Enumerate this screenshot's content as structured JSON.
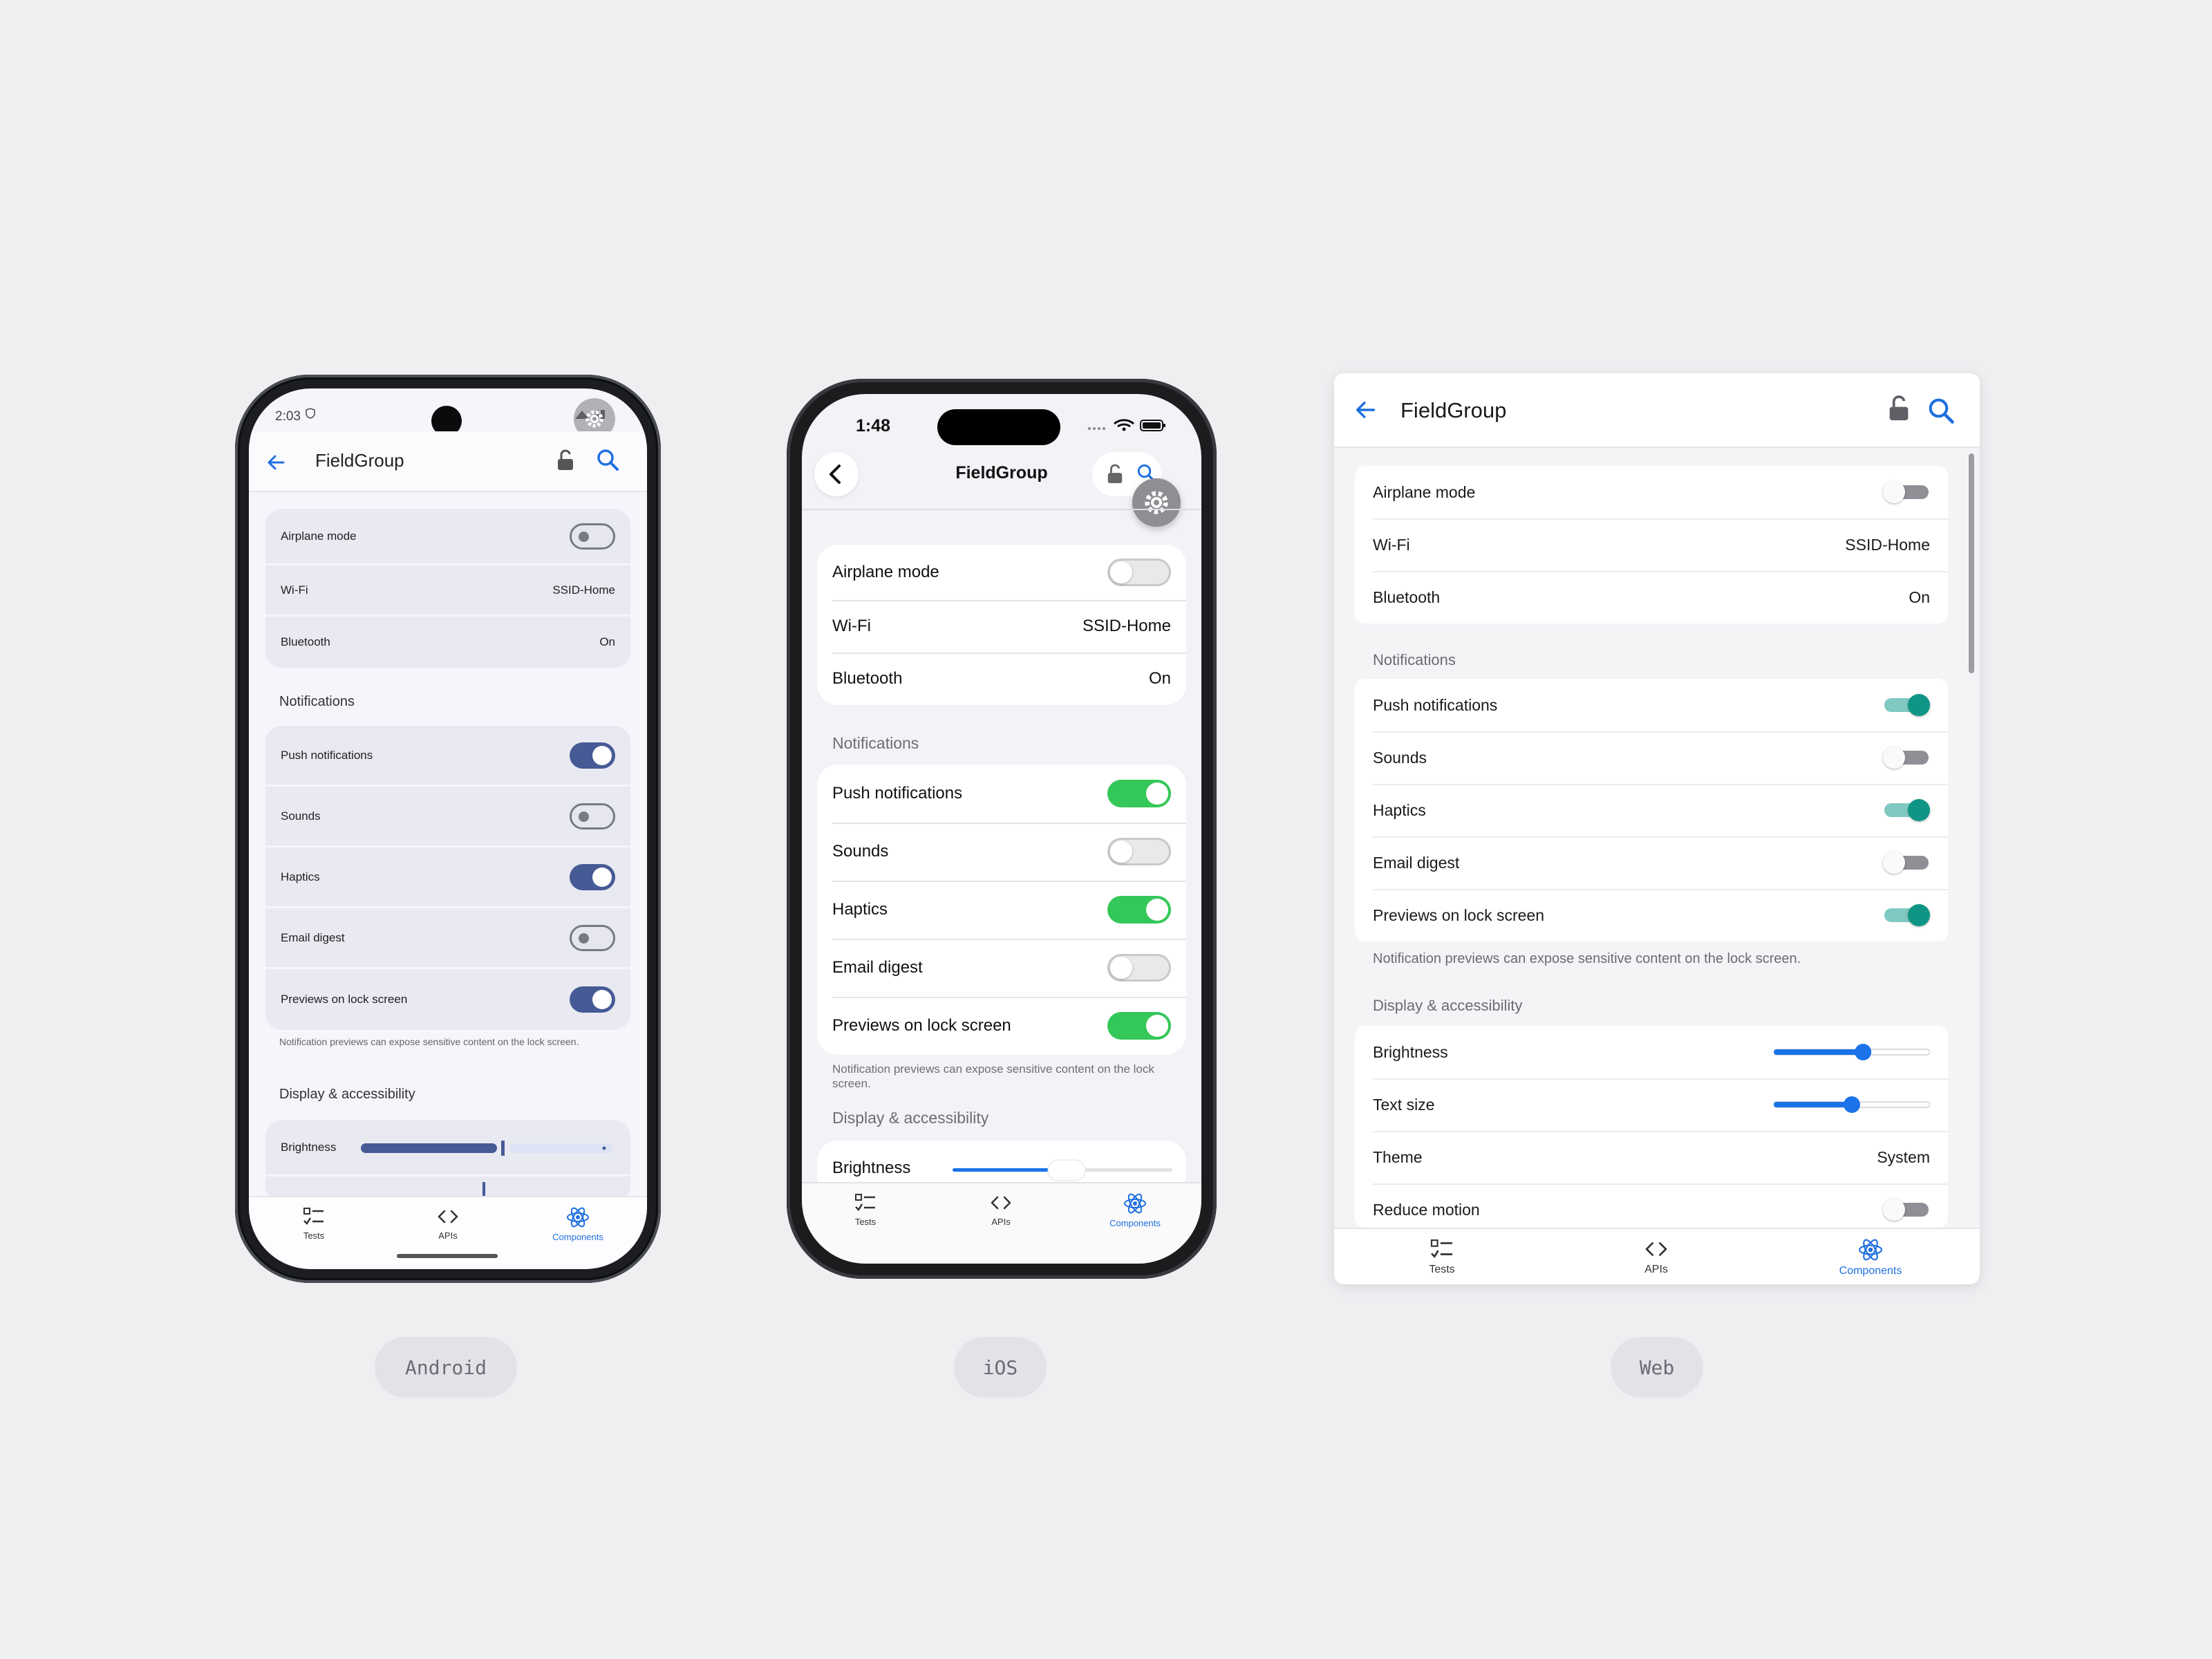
{
  "screen": {
    "title": "FieldGroup",
    "connectivity": [
      {
        "label": "Airplane mode",
        "type": "toggle",
        "on": false
      },
      {
        "label": "Wi-Fi",
        "value": "SSID-Home"
      },
      {
        "label": "Bluetooth",
        "value": "On"
      }
    ],
    "notifications": {
      "heading": "Notifications",
      "items": [
        {
          "label": "Push notifications",
          "on": true
        },
        {
          "label": "Sounds",
          "on": false
        },
        {
          "label": "Haptics",
          "on": true
        },
        {
          "label": "Email digest",
          "on": false
        },
        {
          "label": "Previews on lock screen",
          "on": true
        }
      ],
      "note": "Notification previews can expose sensitive content on the lock screen."
    },
    "display": {
      "heading": "Display & accessibility",
      "brightness_label": "Brightness",
      "brightness_value": 0.58,
      "text_size_label": "Text size",
      "text_size_value": 0.5,
      "theme_label": "Theme",
      "theme_value": "System",
      "reduce_motion_label": "Reduce motion",
      "reduce_motion_on": false
    },
    "tabs": [
      {
        "label": "Tests",
        "icon": "checklist-icon"
      },
      {
        "label": "APIs",
        "icon": "code-icon"
      },
      {
        "label": "Components",
        "icon": "react-atom-icon",
        "active": true
      }
    ]
  },
  "android": {
    "platform_label": "Android",
    "time": "2:03",
    "android_brightness": 0.58
  },
  "ios": {
    "platform_label": "iOS",
    "time": "1:48",
    "ios_brightness": 0.52
  },
  "web": {
    "platform_label": "Web"
  },
  "colors": {
    "android_accent": "#465b95",
    "ios_toggle_on": "#34c759",
    "web_toggle_on": "#0f9585",
    "link_blue": "#1f6fe0",
    "slider_blue": "#1a73e8"
  }
}
